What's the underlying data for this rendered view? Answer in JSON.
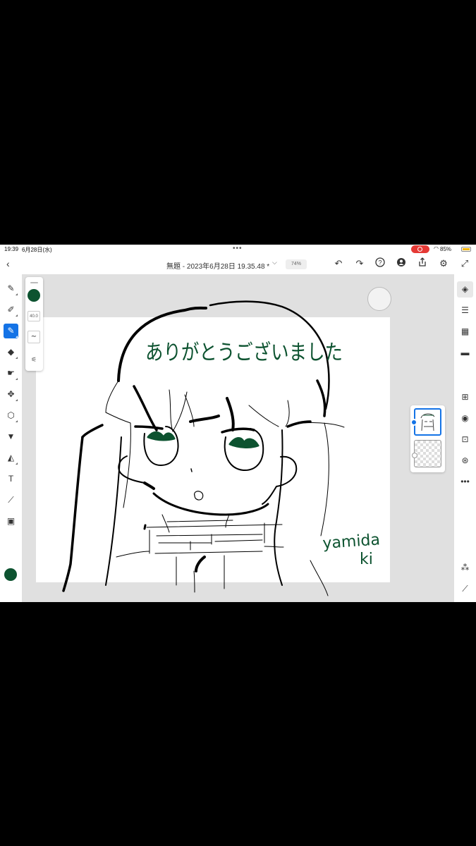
{
  "status_bar": {
    "time": "19:39",
    "date": "6月28日(水)",
    "dots": "•••",
    "battery": "85%",
    "accent_recording": "#e53935",
    "battery_color": "#f4b400"
  },
  "toolbar": {
    "title": "無題 - 2023年6月28日 19.35.48 *",
    "zoom": "74%",
    "icons": [
      "back-icon",
      "chevron-down-icon",
      "undo-icon",
      "redo-icon",
      "help-icon",
      "add-user-icon",
      "share-icon",
      "gear-icon",
      "fullscreen-icon"
    ]
  },
  "brush": {
    "size": "40.0",
    "color": "#0d5330"
  },
  "artwork": {
    "message": "ありがとうございました",
    "signature_line1": "yamida",
    "signature_line2": "ki",
    "ink_color": "#0d5330"
  },
  "left_tools": [
    "fill-brush-icon",
    "pencil-brush-icon",
    "paint-brush-icon",
    "eraser-icon",
    "smudge-icon",
    "move-icon",
    "lasso-icon",
    "fill-bucket-icon",
    "shape-icon",
    "text-icon",
    "eyedropper-icon",
    "image-icon"
  ],
  "right_tools": [
    "layers-icon",
    "adjustments-icon",
    "grid-icon",
    "comments-icon",
    "add-layer-icon",
    "visibility-icon",
    "merge-layer-icon",
    "blend-icon",
    "more-icon",
    "sampler-icon",
    "ruler-icon"
  ]
}
